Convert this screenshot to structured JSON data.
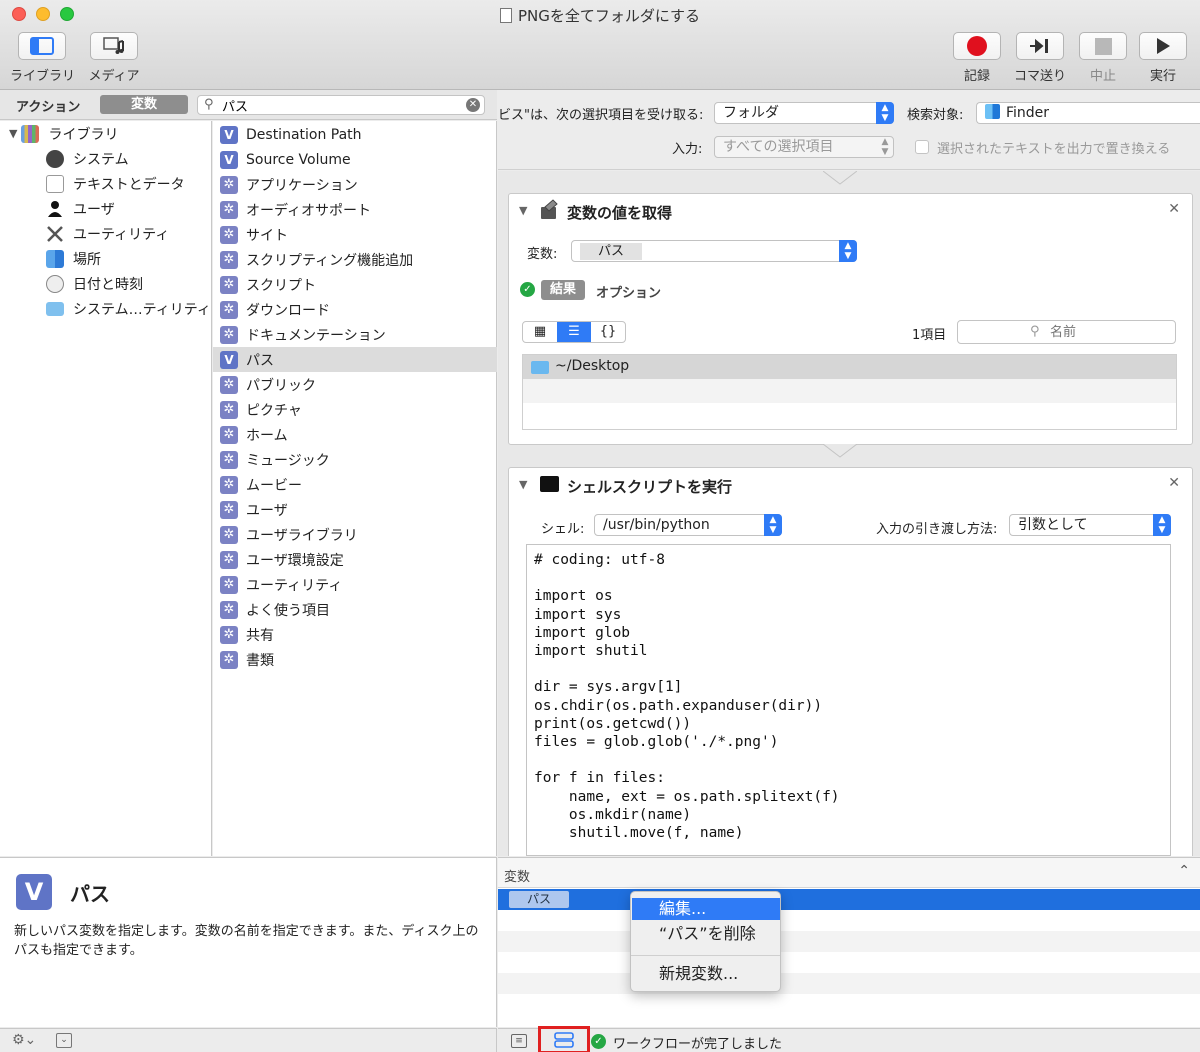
{
  "window": {
    "title": "PNGを全てフォルダにする"
  },
  "toolbar": {
    "library": "ライブラリ",
    "media": "メディア",
    "record": "記録",
    "step": "コマ送り",
    "stop": "中止",
    "run": "実行"
  },
  "left_header": {
    "tab_actions": "アクション",
    "tab_variables": "変数",
    "search_value": "パス"
  },
  "categories": [
    {
      "label": "ライブラリ",
      "icon": "library-books-icon"
    },
    {
      "label": "システム",
      "icon": "system-icon"
    },
    {
      "label": "テキストとデータ",
      "icon": "text-data-icon"
    },
    {
      "label": "ユーザ",
      "icon": "user-icon"
    },
    {
      "label": "ユーティリティ",
      "icon": "utilities-icon"
    },
    {
      "label": "場所",
      "icon": "location-icon"
    },
    {
      "label": "日付と時刻",
      "icon": "clock-icon"
    },
    {
      "label": "システム…ティリティ",
      "icon": "folder-icon"
    }
  ],
  "actions": [
    {
      "label": "Destination Path",
      "icon": "variable-icon"
    },
    {
      "label": "Source Volume",
      "icon": "variable-icon"
    },
    {
      "label": "アプリケーション",
      "icon": "gear-icon"
    },
    {
      "label": "オーディオサポート",
      "icon": "gear-icon"
    },
    {
      "label": "サイト",
      "icon": "gear-icon"
    },
    {
      "label": "スクリプティング機能追加",
      "icon": "gear-icon"
    },
    {
      "label": "スクリプト",
      "icon": "gear-icon"
    },
    {
      "label": "ダウンロード",
      "icon": "gear-icon"
    },
    {
      "label": "ドキュメンテーション",
      "icon": "gear-icon"
    },
    {
      "label": "パス",
      "icon": "variable-icon"
    },
    {
      "label": "パブリック",
      "icon": "gear-icon"
    },
    {
      "label": "ピクチャ",
      "icon": "gear-icon"
    },
    {
      "label": "ホーム",
      "icon": "gear-icon"
    },
    {
      "label": "ミュージック",
      "icon": "gear-icon"
    },
    {
      "label": "ムービー",
      "icon": "gear-icon"
    },
    {
      "label": "ユーザ",
      "icon": "gear-icon"
    },
    {
      "label": "ユーザライブラリ",
      "icon": "gear-icon"
    },
    {
      "label": "ユーザ環境設定",
      "icon": "gear-icon"
    },
    {
      "label": "ユーティリティ",
      "icon": "gear-icon"
    },
    {
      "label": "よく使う項目",
      "icon": "gear-icon"
    },
    {
      "label": "共有",
      "icon": "gear-icon"
    },
    {
      "label": "書類",
      "icon": "gear-icon"
    }
  ],
  "description": {
    "badge": "V",
    "title": "パス",
    "text": "新しいパス変数を指定します。変数の名前を指定できます。また、ディスク上のパスも指定できます。"
  },
  "workflow_header": {
    "receives_label": "ビス\"は、次の選択項目を受け取る:",
    "receives_value": "フォルダ",
    "search_target_label": "検索対象:",
    "search_target_value": "Finder",
    "input_label": "入力:",
    "input_value": "すべての選択項目",
    "replace_label": "選択されたテキストを出力で置き換える"
  },
  "get_var_card": {
    "title": "変数の値を取得",
    "var_label": "変数:",
    "var_value": "パス",
    "results_tab": "結果",
    "options_tab": "オプション",
    "braces": "{}",
    "count": "1項目",
    "filter_placeholder": "名前",
    "result_item": "~/Desktop"
  },
  "shell_card": {
    "title": "シェルスクリプトを実行",
    "shell_label": "シェル:",
    "shell_value": "/usr/bin/python",
    "pass_label": "入力の引き渡し方法:",
    "pass_value": "引数として",
    "script": "# coding: utf-8\n\nimport os\nimport sys\nimport glob\nimport shutil\n\ndir = sys.argv[1]\nos.chdir(os.path.expanduser(dir))\nprint(os.getcwd())\nfiles = glob.glob('./*.png')\n\nfor f in files:\n    name, ext = os.path.splitext(f)\n    os.mkdir(name)\n    shutil.move(f, name)"
  },
  "variables_pane": {
    "header": "変数",
    "token": "パス"
  },
  "context_menu": {
    "edit": "編集...",
    "delete": "“パス”を削除",
    "new": "新規変数..."
  },
  "footer": {
    "status": "ワークフローが完了しました"
  },
  "colors": {
    "accent": "#2f7bf6",
    "selection": "#1f6fde",
    "success": "#25a744",
    "record": "#e0101e"
  }
}
